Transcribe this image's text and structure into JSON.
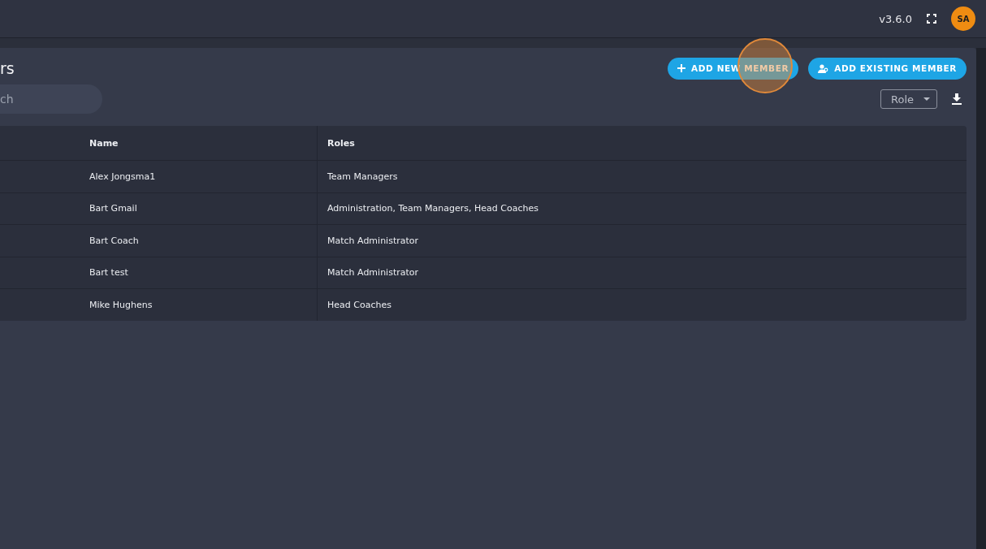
{
  "top_bar": {
    "version": "v3.6.0",
    "avatar_initials": "SA"
  },
  "panel": {
    "title": "rs",
    "search": {
      "value": "ch"
    },
    "buttons": [
      {
        "label": "ADD NEW MEMBER",
        "kind": "plus"
      },
      {
        "label": "ADD EXISTING MEMBER",
        "kind": "person"
      }
    ],
    "role_filter": {
      "label": "Role"
    }
  },
  "table": {
    "columns": [
      "Name",
      "Roles"
    ],
    "rows": [
      [
        "Alex Jongsma1",
        "Team Managers"
      ],
      [
        "Bart Gmail",
        "Administration, Team Managers, Head Coaches"
      ],
      [
        "Bart Coach",
        "Match Administrator"
      ],
      [
        "Bart test",
        "Match Administrator"
      ],
      [
        "Mike Hughens",
        "Head Coaches"
      ]
    ]
  }
}
